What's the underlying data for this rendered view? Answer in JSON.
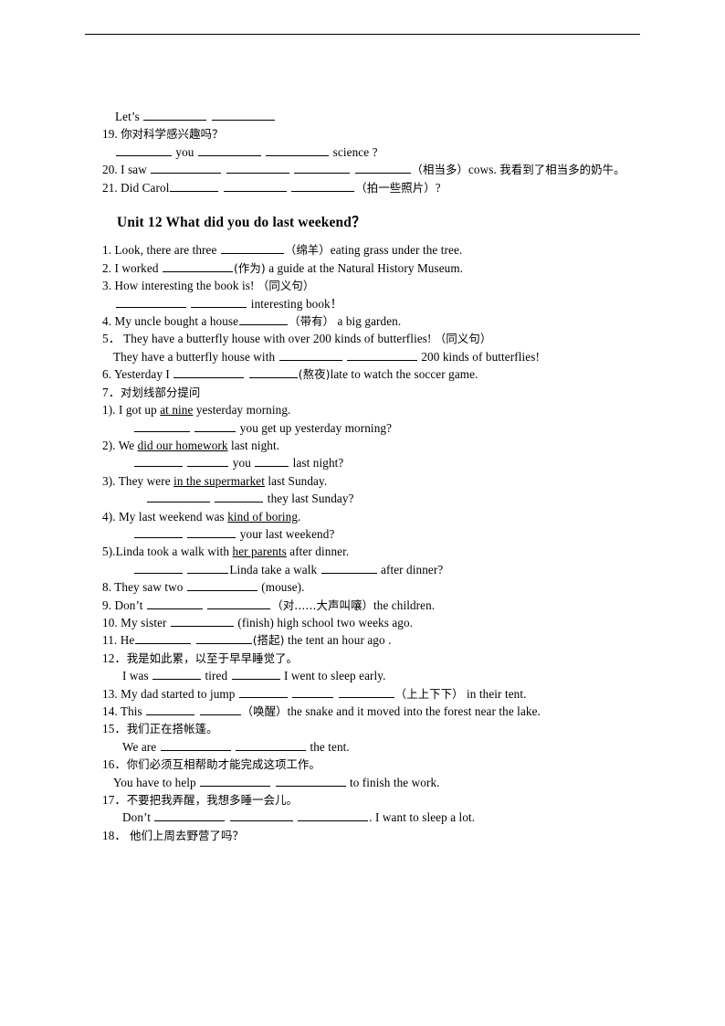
{
  "document": {
    "type": "worksheet",
    "has_header_rule": true,
    "page_background": "#ffffff",
    "text_color": "#000000"
  },
  "prev_section": {
    "lines": [
      {
        "id": "lets-line",
        "indent": "ind1",
        "parts": [
          {
            "t": "text",
            "v": "Let’s "
          },
          {
            "t": "blank",
            "len": 9
          },
          {
            "t": "text",
            "v": " "
          },
          {
            "t": "blank",
            "len": 9
          }
        ]
      },
      {
        "id": "item-19",
        "indent": "none",
        "parts": [
          {
            "t": "text",
            "v": "19. "
          },
          {
            "t": "cn",
            "v": "你对科学感兴趣吗？"
          }
        ]
      },
      {
        "id": "item-19-answer",
        "indent": "ind1",
        "parts": [
          {
            "t": "blank",
            "len": 8
          },
          {
            "t": "text",
            "v": " you "
          },
          {
            "t": "blank",
            "len": 9
          },
          {
            "t": "text",
            "v": " "
          },
          {
            "t": "blank",
            "len": 9
          },
          {
            "t": "text",
            "v": " science ?"
          }
        ]
      },
      {
        "id": "item-20",
        "indent": "none",
        "parts": [
          {
            "t": "text",
            "v": "20. I saw "
          },
          {
            "t": "blank",
            "len": 10
          },
          {
            "t": "text",
            "v": " "
          },
          {
            "t": "blank",
            "len": 9
          },
          {
            "t": "text",
            "v": " "
          },
          {
            "t": "blank",
            "len": 8
          },
          {
            "t": "text",
            "v": " "
          },
          {
            "t": "blank",
            "len": 8
          },
          {
            "t": "cn",
            "v": "（相当多）"
          },
          {
            "t": "text",
            "v": "cows. "
          },
          {
            "t": "cn",
            "v": "我看到了相当多的奶牛。"
          }
        ]
      },
      {
        "id": "item-21",
        "indent": "none",
        "parts": [
          {
            "t": "text",
            "v": "21. Did Carol"
          },
          {
            "t": "blank",
            "len": 7
          },
          {
            "t": "text",
            "v": " "
          },
          {
            "t": "blank",
            "len": 9
          },
          {
            "t": "text",
            "v": " "
          },
          {
            "t": "blank",
            "len": 9
          },
          {
            "t": "cn",
            "v": "（拍一些照片）"
          },
          {
            "t": "text",
            "v": "?"
          }
        ]
      }
    ]
  },
  "unit_title": "Unit 12    What did you do last weekend？",
  "unit12": {
    "lines": [
      {
        "id": "q1",
        "indent": "none",
        "parts": [
          {
            "t": "text",
            "v": "1. Look, there are three "
          },
          {
            "t": "blank",
            "len": 9
          },
          {
            "t": "cn",
            "v": "（绵羊）"
          },
          {
            "t": "text",
            "v": "eating grass under the tree."
          }
        ]
      },
      {
        "id": "q2",
        "indent": "none",
        "parts": [
          {
            "t": "text",
            "v": "2. I worked "
          },
          {
            "t": "blank",
            "len": 10
          },
          {
            "t": "cn",
            "v": "(作为)"
          },
          {
            "t": "text",
            "v": " a guide at the Natural History Museum."
          }
        ]
      },
      {
        "id": "q3",
        "indent": "none",
        "parts": [
          {
            "t": "text",
            "v": "3. How interesting the book is!  "
          },
          {
            "t": "cn",
            "v": "（同义句）"
          }
        ]
      },
      {
        "id": "q3-answer",
        "indent": "ind1",
        "parts": [
          {
            "t": "blank",
            "len": 10
          },
          {
            "t": "text",
            "v": " "
          },
          {
            "t": "blank",
            "len": 8
          },
          {
            "t": "text",
            "v": " interesting book！"
          }
        ]
      },
      {
        "id": "q4",
        "indent": "none",
        "parts": [
          {
            "t": "text",
            "v": "4. My uncle bought a house"
          },
          {
            "t": "blank",
            "len": 7
          },
          {
            "t": "cn",
            "v": "（带有）"
          },
          {
            "t": "text",
            "v": "   a big garden."
          }
        ]
      },
      {
        "id": "q5",
        "indent": "none",
        "parts": [
          {
            "t": "text",
            "v": "5． They have a butterfly house with over 200 kinds of butterflies!  "
          },
          {
            "t": "cn",
            "v": "（同义句）"
          }
        ]
      },
      {
        "id": "q5-answer",
        "indent": "ind5",
        "parts": [
          {
            "t": "text",
            "v": "They have a butterfly house with "
          },
          {
            "t": "blank",
            "len": 9
          },
          {
            "t": "text",
            "v": " "
          },
          {
            "t": "blank",
            "len": 10
          },
          {
            "t": "text",
            "v": " 200 kinds of butterflies!"
          }
        ]
      },
      {
        "id": "q6",
        "indent": "none",
        "parts": [
          {
            "t": "text",
            "v": "6. Yesterday I "
          },
          {
            "t": "blank",
            "len": 10
          },
          {
            "t": "text",
            "v": " "
          },
          {
            "t": "blank",
            "len": 7
          },
          {
            "t": "cn",
            "v": "(熬夜)"
          },
          {
            "t": "text",
            "v": "late to watch the soccer game."
          }
        ]
      },
      {
        "id": "q7",
        "indent": "none",
        "parts": [
          {
            "t": "text",
            "v": "7．"
          },
          {
            "t": "cn",
            "v": "对划线部分提问"
          }
        ]
      },
      {
        "id": "q7-1",
        "indent": "none",
        "parts": [
          {
            "t": "text",
            "v": "1). I got up "
          },
          {
            "t": "u",
            "v": "at nine"
          },
          {
            "t": "text",
            "v": " yesterday morning."
          }
        ]
      },
      {
        "id": "q7-1-answer",
        "indent": "ind3",
        "parts": [
          {
            "t": "blank",
            "len": 8
          },
          {
            "t": "text",
            "v": " "
          },
          {
            "t": "blank",
            "len": 6
          },
          {
            "t": "text",
            "v": " you get up yesterday morning?"
          }
        ]
      },
      {
        "id": "q7-2",
        "indent": "none",
        "parts": [
          {
            "t": "text",
            "v": "2). We "
          },
          {
            "t": "u",
            "v": "did our homework"
          },
          {
            "t": "text",
            "v": " last night."
          }
        ]
      },
      {
        "id": "q7-2-answer",
        "indent": "ind3",
        "parts": [
          {
            "t": "blank",
            "len": 7
          },
          {
            "t": "text",
            "v": " "
          },
          {
            "t": "blank",
            "len": 6
          },
          {
            "t": "text",
            "v": " you "
          },
          {
            "t": "blank",
            "len": 5
          },
          {
            "t": "text",
            "v": " last night?"
          }
        ]
      },
      {
        "id": "q7-3",
        "indent": "none",
        "parts": [
          {
            "t": "text",
            "v": "3). They were "
          },
          {
            "t": "u",
            "v": "in the supermarket"
          },
          {
            "t": "text",
            "v": " last Sunday."
          }
        ]
      },
      {
        "id": "q7-3-answer",
        "indent": "ind4",
        "parts": [
          {
            "t": "blank",
            "len": 9
          },
          {
            "t": "text",
            "v": " "
          },
          {
            "t": "blank",
            "len": 7
          },
          {
            "t": "text",
            "v": " they last Sunday?"
          }
        ]
      },
      {
        "id": "q7-4",
        "indent": "none",
        "parts": [
          {
            "t": "text",
            "v": "4). My last weekend was "
          },
          {
            "t": "u",
            "v": "kind of boring"
          },
          {
            "t": "text",
            "v": "."
          }
        ]
      },
      {
        "id": "q7-4-answer",
        "indent": "ind3",
        "parts": [
          {
            "t": "blank",
            "len": 7
          },
          {
            "t": "text",
            "v": " "
          },
          {
            "t": "blank",
            "len": 7
          },
          {
            "t": "text",
            "v": " your last weekend?"
          }
        ]
      },
      {
        "id": "q7-5",
        "indent": "none",
        "parts": [
          {
            "t": "text",
            "v": "5).Linda took a walk with "
          },
          {
            "t": "u",
            "v": "her parents"
          },
          {
            "t": "text",
            "v": " after dinner."
          }
        ]
      },
      {
        "id": "q7-5-answer",
        "indent": "ind3",
        "parts": [
          {
            "t": "blank",
            "len": 7
          },
          {
            "t": "text",
            "v": " "
          },
          {
            "t": "blank",
            "len": 6
          },
          {
            "t": "text",
            "v": "Linda take a walk "
          },
          {
            "t": "blank",
            "len": 8
          },
          {
            "t": "text",
            "v": " after dinner?"
          }
        ]
      },
      {
        "id": "q8",
        "indent": "none",
        "parts": [
          {
            "t": "text",
            "v": "8. They saw two "
          },
          {
            "t": "blank",
            "len": 10
          },
          {
            "t": "text",
            "v": " (mouse)."
          }
        ]
      },
      {
        "id": "q9",
        "indent": "none",
        "parts": [
          {
            "t": "text",
            "v": "9. Don’t "
          },
          {
            "t": "blank",
            "len": 8
          },
          {
            "t": "text",
            "v": " "
          },
          {
            "t": "blank",
            "len": 9
          },
          {
            "t": "cn",
            "v": "（对......大声叫嚷）"
          },
          {
            "t": "text",
            "v": "the children."
          }
        ]
      },
      {
        "id": "q10",
        "indent": "none",
        "parts": [
          {
            "t": "text",
            "v": "10. My sister "
          },
          {
            "t": "blank",
            "len": 9
          },
          {
            "t": "text",
            "v": " (finish) high school two weeks ago."
          }
        ]
      },
      {
        "id": "q11",
        "indent": "none",
        "parts": [
          {
            "t": "text",
            "v": "11. He"
          },
          {
            "t": "blank",
            "len": 8
          },
          {
            "t": "text",
            "v": " "
          },
          {
            "t": "blank",
            "len": 8
          },
          {
            "t": "cn",
            "v": "(搭起)"
          },
          {
            "t": "text",
            "v": " the tent an hour ago ."
          }
        ]
      },
      {
        "id": "q12",
        "indent": "none",
        "parts": [
          {
            "t": "text",
            "v": "12．"
          },
          {
            "t": "cn",
            "v": "我是如此累，以至于早早睡觉了。"
          }
        ]
      },
      {
        "id": "q12-answer",
        "indent": "ind2",
        "parts": [
          {
            "t": "text",
            "v": "I was "
          },
          {
            "t": "blank",
            "len": 7
          },
          {
            "t": "text",
            "v": " tired "
          },
          {
            "t": "blank",
            "len": 7
          },
          {
            "t": "text",
            "v": " I went to sleep early."
          }
        ]
      },
      {
        "id": "q13",
        "indent": "none",
        "parts": [
          {
            "t": "text",
            "v": "13. My dad started to jump "
          },
          {
            "t": "blank",
            "len": 7
          },
          {
            "t": "text",
            "v": " "
          },
          {
            "t": "blank",
            "len": 6
          },
          {
            "t": "text",
            "v": " "
          },
          {
            "t": "blank",
            "len": 8
          },
          {
            "t": "cn",
            "v": "（上上下下）"
          },
          {
            "t": "text",
            "v": "  in their tent."
          }
        ]
      },
      {
        "id": "q14",
        "indent": "none",
        "parts": [
          {
            "t": "text",
            "v": "14. This "
          },
          {
            "t": "blank",
            "len": 7
          },
          {
            "t": "text",
            "v": " "
          },
          {
            "t": "blank",
            "len": 6
          },
          {
            "t": "cn",
            "v": "（唤醒）"
          },
          {
            "t": "text",
            "v": "the snake and it moved into the forest near the lake."
          }
        ]
      },
      {
        "id": "q15",
        "indent": "none",
        "parts": [
          {
            "t": "text",
            "v": "15．"
          },
          {
            "t": "cn",
            "v": "我们正在搭帐篷。"
          }
        ]
      },
      {
        "id": "q15-answer",
        "indent": "ind2",
        "parts": [
          {
            "t": "text",
            "v": "We are "
          },
          {
            "t": "blank",
            "len": 10
          },
          {
            "t": "text",
            "v": " "
          },
          {
            "t": "blank",
            "len": 10
          },
          {
            "t": "text",
            "v": " the tent."
          }
        ]
      },
      {
        "id": "q16",
        "indent": "none",
        "parts": [
          {
            "t": "text",
            "v": "16．"
          },
          {
            "t": "cn",
            "v": "你们必须互相帮助才能完成这项工作。"
          }
        ]
      },
      {
        "id": "q16-answer",
        "indent": "ind5",
        "parts": [
          {
            "t": "text",
            "v": "You have to help "
          },
          {
            "t": "blank",
            "len": 10
          },
          {
            "t": "text",
            "v": " "
          },
          {
            "t": "blank",
            "len": 10
          },
          {
            "t": "text",
            "v": " to finish the work."
          }
        ]
      },
      {
        "id": "q17",
        "indent": "none",
        "parts": [
          {
            "t": "text",
            "v": "17．"
          },
          {
            "t": "cn",
            "v": "不要把我弄醒，我想多睡一会儿。"
          }
        ]
      },
      {
        "id": "q17-answer",
        "indent": "ind2",
        "parts": [
          {
            "t": "text",
            "v": "Don’t "
          },
          {
            "t": "blank",
            "len": 10
          },
          {
            "t": "text",
            "v": " "
          },
          {
            "t": "blank",
            "len": 9
          },
          {
            "t": "text",
            "v": " "
          },
          {
            "t": "blank",
            "len": 10
          },
          {
            "t": "text",
            "v": ". I want to sleep a lot."
          }
        ]
      },
      {
        "id": "q18",
        "indent": "none",
        "parts": [
          {
            "t": "text",
            "v": "18． "
          },
          {
            "t": "cn",
            "v": "他们上周去野营了吗？"
          }
        ]
      }
    ]
  }
}
